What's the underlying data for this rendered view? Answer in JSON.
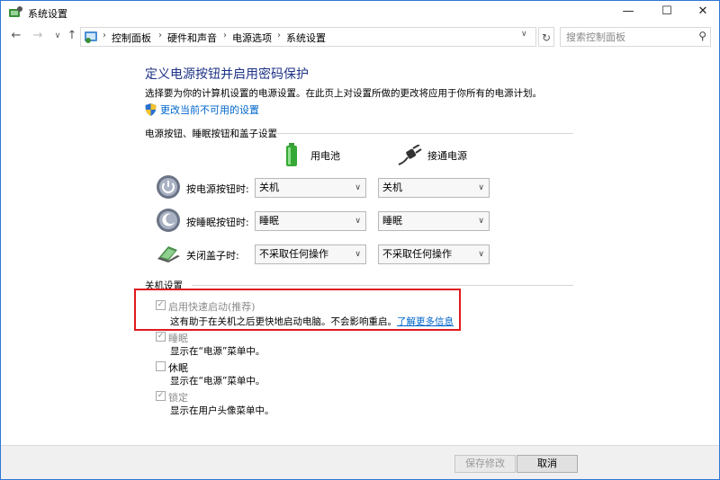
{
  "window": {
    "title": "系统设置",
    "min_glyph": "—",
    "max_glyph": "☐",
    "close_glyph": "✕"
  },
  "nav": {
    "back_glyph": "←",
    "forward_glyph": "→",
    "recent_glyph": "∨",
    "up_glyph": "↑",
    "breadcrumb": [
      "控制面板",
      "硬件和声音",
      "电源选项",
      "系统设置"
    ],
    "separator": "›",
    "dropdown_glyph": "∨",
    "refresh_glyph": "↻",
    "search_placeholder": "搜索控制面板",
    "search_glyph": "⚲"
  },
  "page": {
    "heading": "定义电源按钮并启用密码保护",
    "description": "选择要为你的计算机设置的电源设置。在此页上对设置所做的更改将应用于你所有的电源计划。",
    "change_unavailable_link": "更改当前不可用的设置"
  },
  "power_buttons": {
    "section_title": "电源按钮、睡眠按钮和盖子设置",
    "battery_label": "用电池",
    "plugged_label": "接通电源",
    "rows": [
      {
        "label": "按电源按钮时:",
        "battery": "关机",
        "plugged": "关机",
        "icon": "power-button-icon"
      },
      {
        "label": "按睡眠按钮时:",
        "battery": "睡眠",
        "plugged": "睡眠",
        "icon": "sleep-button-icon"
      },
      {
        "label": "关闭盖子时:",
        "battery": "不采取任何操作",
        "plugged": "不采取任何操作",
        "icon": "laptop-lid-icon"
      }
    ]
  },
  "shutdown": {
    "section_title": "关机设置",
    "fast_startup": {
      "label": "启用快速启动(推荐)",
      "desc": "这有助于在关机之后更快地启动电脑。不会影响重启。",
      "link": "了解更多信息",
      "checked": true
    },
    "sleep": {
      "label": "睡眠",
      "desc": "显示在“电源”菜单中。",
      "checked": true
    },
    "hibernate": {
      "label": "休眠",
      "desc": "显示在“电源”菜单中。",
      "checked": false
    },
    "lock": {
      "label": "锁定",
      "desc": "显示在用户头像菜单中。",
      "checked": true
    }
  },
  "footer": {
    "save_label": "保存修改",
    "cancel_label": "取消"
  },
  "colors": {
    "heading": "#1e3287",
    "link": "#0066cc",
    "highlight": "#e0191c",
    "window_border": "#2b78d4"
  }
}
